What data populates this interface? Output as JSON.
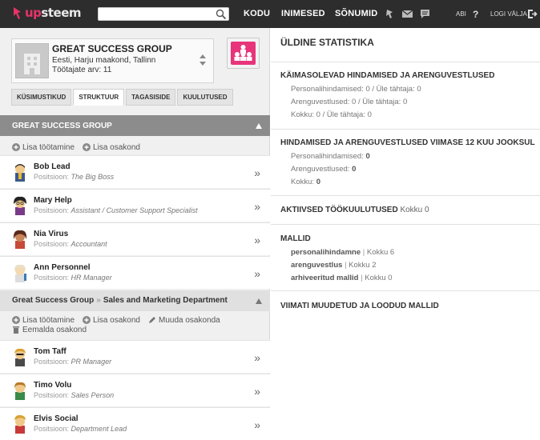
{
  "app": {
    "logo_part1": "up",
    "logo_part2": "steem"
  },
  "topnav": {
    "search_placeholder": "",
    "items": [
      "KODU",
      "INIMESED",
      "SÕNUMID"
    ],
    "help_label": "ABI",
    "logout_label": "LOGI VÄLJA"
  },
  "company": {
    "name": "GREAT SUCCESS GROUP",
    "location": "Eesti, Harju maakond, Tallinn",
    "employees": "Töötajate arv: 11"
  },
  "tabs": [
    "KÜSIMUSTIKUD",
    "STRUKTUUR",
    "TAGASISIDE",
    "KUULUTUSED"
  ],
  "active_tab": "STRUKTUUR",
  "group": {
    "title": "GREAT SUCCESS GROUP",
    "actions": [
      "Lisa töötamine",
      "Lisa osakond"
    ],
    "members": [
      {
        "name": "Bob Lead",
        "position_label": "Positsioon:",
        "position": "The Big Boss"
      },
      {
        "name": "Mary Help",
        "position_label": "Positsioon:",
        "position": "Assistant / Customer Support Specialist"
      },
      {
        "name": "Nia Virus",
        "position_label": "Positsioon:",
        "position": "Accountant"
      },
      {
        "name": "Ann Personnel",
        "position_label": "Positsioon:",
        "position": "HR Manager"
      }
    ]
  },
  "department": {
    "company": "Great Success Group",
    "separator": "»",
    "name": "Sales and Marketing Department",
    "actions": [
      "Lisa töötamine",
      "Lisa osakond",
      "Muuda osakonda",
      "Eemalda osakond"
    ],
    "members": [
      {
        "name": "Tom Taff",
        "position_label": "Positsioon:",
        "position": "PR Manager"
      },
      {
        "name": "Timo Volu",
        "position_label": "Positsioon:",
        "position": "Sales Person"
      },
      {
        "name": "Elvis Social",
        "position_label": "Positsioon:",
        "position": "Department Lead"
      }
    ]
  },
  "stats": {
    "title": "ÜLDINE STATISTIKA",
    "ongoing": {
      "heading": "KÄIMASOLEVAD HINDAMISED JA ARENGUVESTLUSED",
      "lines": [
        "Personalihindamised: 0 / Üle tähtaja: 0",
        "Arenguvestlused: 0 / Üle tähtaja: 0",
        "Kokku: 0 / Üle tähtaja: 0"
      ]
    },
    "last12": {
      "heading": "HINDAMISED JA ARENGUVESTLUSED VIIMASE 12 KUU JOOKSUL",
      "lines": [
        {
          "label": "Personalihindamised:",
          "value": "0"
        },
        {
          "label": "Arenguvestlused:",
          "value": "0"
        },
        {
          "label": "Kokku:",
          "value": "0"
        }
      ]
    },
    "ads": {
      "heading": "AKTIIVSED TÖÖKUULUTUSED",
      "count": "Kokku 0"
    },
    "templates": {
      "heading": "MALLID",
      "items": [
        {
          "name": "personalihindamne",
          "count": "Kokku 6"
        },
        {
          "name": "arenguvestlus",
          "count": "Kokku 2"
        },
        {
          "name": "arhiveeritud mallid",
          "count": "Kokku 0"
        }
      ]
    },
    "recent": {
      "heading": "VIIMATI MUUDETUD JA LOODUD MALLID"
    }
  }
}
